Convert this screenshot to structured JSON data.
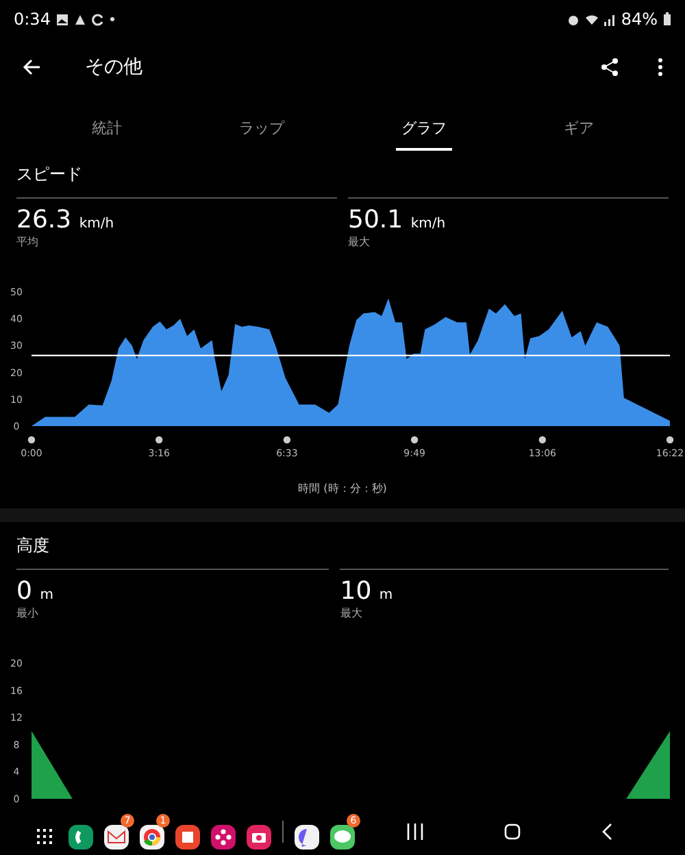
{
  "status_bar": {
    "time": "0:34",
    "battery": "84%"
  },
  "app_bar": {
    "title": "その他"
  },
  "tabs": [
    {
      "label": "統計",
      "selected": false
    },
    {
      "label": "ラップ",
      "selected": false
    },
    {
      "label": "グラフ",
      "selected": true
    },
    {
      "label": "ギア",
      "selected": false
    }
  ],
  "sections": [
    {
      "title": "スピード",
      "stats": [
        {
          "value": "26.3",
          "unit": "km/h",
          "label": "平均"
        },
        {
          "value": "50.1",
          "unit": "km/h",
          "label": "最大"
        }
      ],
      "chart_data": {
        "type": "area",
        "xlabel": "時間 (時：分：秒)",
        "xlim": [
          0,
          16.37
        ],
        "ylim": [
          0,
          50
        ],
        "yticks": [
          0,
          10,
          20,
          30,
          40,
          50
        ],
        "xticks": [
          {
            "value": 0,
            "label": "0:00"
          },
          {
            "value": 3.27,
            "label": "3:16"
          },
          {
            "value": 6.55,
            "label": "6:33"
          },
          {
            "value": 9.82,
            "label": "9:49"
          },
          {
            "value": 13.1,
            "label": "13:06"
          },
          {
            "value": 16.37,
            "label": "16:22"
          }
        ],
        "x": [
          0,
          0.35,
          1.11,
          1.47,
          1.82,
          2.05,
          2.23,
          2.41,
          2.58,
          2.7,
          2.87,
          3.11,
          3.29,
          3.46,
          3.64,
          3.81,
          3.99,
          4.17,
          4.34,
          4.63,
          4.69,
          4.87,
          5.05,
          5.22,
          5.4,
          5.57,
          5.81,
          6.1,
          6.28,
          6.51,
          6.86,
          7.27,
          7.63,
          7.86,
          8.15,
          8.33,
          8.51,
          8.8,
          8.98,
          9.15,
          9.33,
          9.5,
          9.62,
          9.8,
          9.97,
          10.09,
          10.33,
          10.62,
          10.91,
          11.15,
          11.24,
          11.44,
          11.73,
          11.91,
          12.14,
          12.38,
          12.55,
          12.65,
          12.79,
          13.02,
          13.26,
          13.61,
          13.85,
          14.08,
          14.2,
          14.49,
          14.78,
          15.08,
          15.19,
          16.37
        ],
        "series": [
          {
            "color": "#3b8ee8",
            "values": [
              0,
              3.4,
              3.4,
              8,
              7.7,
              17,
              29,
              33,
              30,
              25,
              32,
              37,
              39,
              36,
              37.5,
              40,
              33.5,
              36,
              29,
              32,
              26,
              13,
              19,
              38,
              37,
              37.5,
              37,
              36,
              29,
              18,
              8,
              8,
              5,
              8,
              30,
              39.5,
              42,
              42.5,
              41,
              47.6,
              38.6,
              38.6,
              25,
              27,
              27,
              36,
              37.8,
              40.6,
              38.6,
              38.6,
              26.7,
              31.8,
              43.7,
              42,
              45.4,
              41,
              42,
              25,
              32.7,
              33.5,
              36,
              43,
              33,
              35.4,
              30,
              38.6,
              37,
              30,
              10.5,
              2
            ]
          }
        ],
        "ref_lines": [
          {
            "axis": "y",
            "value": 26.3
          }
        ]
      }
    },
    {
      "title": "高度",
      "stats": [
        {
          "value": "0",
          "unit": "m",
          "label": "最小"
        },
        {
          "value": "10",
          "unit": "m",
          "label": "最大"
        }
      ],
      "chart_data": {
        "type": "area",
        "xlim": [
          0,
          16.37
        ],
        "ylim": [
          0,
          20
        ],
        "yticks": [
          0,
          4,
          8,
          12,
          16,
          20
        ],
        "x": [
          0,
          1.05,
          15.25,
          16.37
        ],
        "series": [
          {
            "color": "#1fa04a",
            "values": [
              10,
              0,
              0,
              10
            ]
          }
        ]
      }
    }
  ],
  "dock": [
    {
      "kind": "drawer"
    },
    {
      "kind": "phone"
    },
    {
      "kind": "mail",
      "badge": "7"
    },
    {
      "kind": "browser",
      "badge": "1"
    },
    {
      "kind": "notes"
    },
    {
      "kind": "flower"
    },
    {
      "kind": "camera"
    },
    {
      "kind": "divider"
    },
    {
      "kind": "messenger"
    },
    {
      "kind": "chat",
      "badge": "6"
    }
  ]
}
